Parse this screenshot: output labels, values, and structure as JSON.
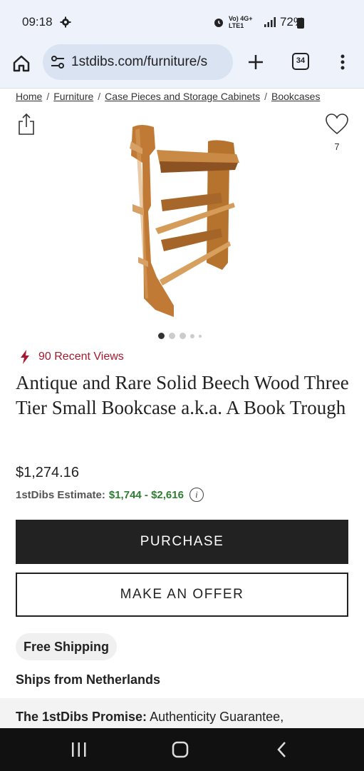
{
  "status_bar": {
    "time": "09:18",
    "network": "Vo) 4G+ LTE1",
    "battery": "72%",
    "icons": [
      "gear-icon",
      "alarm-icon",
      "signal-icon",
      "battery-icon"
    ]
  },
  "browser": {
    "url": "1stdibs.com/furniture/s",
    "tab_count": "34",
    "icons": [
      "home-icon",
      "tune-icon",
      "plus-icon",
      "tabs-icon",
      "more-vert-icon"
    ]
  },
  "breadcrumb": {
    "items": [
      "Home",
      "Furniture",
      "Case Pieces and Storage Cabinets",
      "Bookcases"
    ],
    "separator": "/"
  },
  "product": {
    "favorite_count": "7",
    "image_count": 5,
    "active_image": 1,
    "recent_views": "90 Recent Views",
    "title": "Antique and Rare Solid Beech Wood Three Tier Small Bookcase a.k.a. A Book Trough",
    "price": "$1,274.16",
    "estimate_label": "1stDibs Estimate:",
    "estimate_range": "$1,744 - $2,616",
    "info_glyph": "i"
  },
  "actions": {
    "purchase": "PURCHASE",
    "offer": "MAKE AN OFFER"
  },
  "shipping": {
    "badge": "Free Shipping",
    "origin": "Ships from Netherlands"
  },
  "promise": {
    "label": "The 1stDibs Promise:",
    "text": "Authenticity Guarantee,"
  },
  "colors": {
    "accent_red": "#a6192e",
    "estimate_green": "#2e7d32",
    "button_dark": "#222222"
  }
}
